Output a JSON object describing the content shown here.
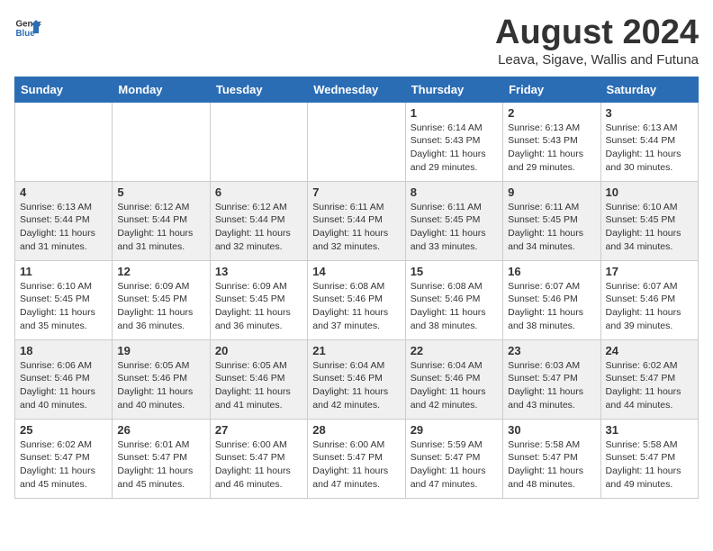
{
  "logo": {
    "general": "General",
    "blue": "Blue"
  },
  "title": {
    "month": "August 2024",
    "location": "Leava, Sigave, Wallis and Futuna"
  },
  "weekdays": [
    "Sunday",
    "Monday",
    "Tuesday",
    "Wednesday",
    "Thursday",
    "Friday",
    "Saturday"
  ],
  "weeks": [
    [
      {
        "day": "",
        "info": ""
      },
      {
        "day": "",
        "info": ""
      },
      {
        "day": "",
        "info": ""
      },
      {
        "day": "",
        "info": ""
      },
      {
        "day": "1",
        "info": "Sunrise: 6:14 AM\nSunset: 5:43 PM\nDaylight: 11 hours\nand 29 minutes."
      },
      {
        "day": "2",
        "info": "Sunrise: 6:13 AM\nSunset: 5:43 PM\nDaylight: 11 hours\nand 29 minutes."
      },
      {
        "day": "3",
        "info": "Sunrise: 6:13 AM\nSunset: 5:44 PM\nDaylight: 11 hours\nand 30 minutes."
      }
    ],
    [
      {
        "day": "4",
        "info": "Sunrise: 6:13 AM\nSunset: 5:44 PM\nDaylight: 11 hours\nand 31 minutes."
      },
      {
        "day": "5",
        "info": "Sunrise: 6:12 AM\nSunset: 5:44 PM\nDaylight: 11 hours\nand 31 minutes."
      },
      {
        "day": "6",
        "info": "Sunrise: 6:12 AM\nSunset: 5:44 PM\nDaylight: 11 hours\nand 32 minutes."
      },
      {
        "day": "7",
        "info": "Sunrise: 6:11 AM\nSunset: 5:44 PM\nDaylight: 11 hours\nand 32 minutes."
      },
      {
        "day": "8",
        "info": "Sunrise: 6:11 AM\nSunset: 5:45 PM\nDaylight: 11 hours\nand 33 minutes."
      },
      {
        "day": "9",
        "info": "Sunrise: 6:11 AM\nSunset: 5:45 PM\nDaylight: 11 hours\nand 34 minutes."
      },
      {
        "day": "10",
        "info": "Sunrise: 6:10 AM\nSunset: 5:45 PM\nDaylight: 11 hours\nand 34 minutes."
      }
    ],
    [
      {
        "day": "11",
        "info": "Sunrise: 6:10 AM\nSunset: 5:45 PM\nDaylight: 11 hours\nand 35 minutes."
      },
      {
        "day": "12",
        "info": "Sunrise: 6:09 AM\nSunset: 5:45 PM\nDaylight: 11 hours\nand 36 minutes."
      },
      {
        "day": "13",
        "info": "Sunrise: 6:09 AM\nSunset: 5:45 PM\nDaylight: 11 hours\nand 36 minutes."
      },
      {
        "day": "14",
        "info": "Sunrise: 6:08 AM\nSunset: 5:46 PM\nDaylight: 11 hours\nand 37 minutes."
      },
      {
        "day": "15",
        "info": "Sunrise: 6:08 AM\nSunset: 5:46 PM\nDaylight: 11 hours\nand 38 minutes."
      },
      {
        "day": "16",
        "info": "Sunrise: 6:07 AM\nSunset: 5:46 PM\nDaylight: 11 hours\nand 38 minutes."
      },
      {
        "day": "17",
        "info": "Sunrise: 6:07 AM\nSunset: 5:46 PM\nDaylight: 11 hours\nand 39 minutes."
      }
    ],
    [
      {
        "day": "18",
        "info": "Sunrise: 6:06 AM\nSunset: 5:46 PM\nDaylight: 11 hours\nand 40 minutes."
      },
      {
        "day": "19",
        "info": "Sunrise: 6:05 AM\nSunset: 5:46 PM\nDaylight: 11 hours\nand 40 minutes."
      },
      {
        "day": "20",
        "info": "Sunrise: 6:05 AM\nSunset: 5:46 PM\nDaylight: 11 hours\nand 41 minutes."
      },
      {
        "day": "21",
        "info": "Sunrise: 6:04 AM\nSunset: 5:46 PM\nDaylight: 11 hours\nand 42 minutes."
      },
      {
        "day": "22",
        "info": "Sunrise: 6:04 AM\nSunset: 5:46 PM\nDaylight: 11 hours\nand 42 minutes."
      },
      {
        "day": "23",
        "info": "Sunrise: 6:03 AM\nSunset: 5:47 PM\nDaylight: 11 hours\nand 43 minutes."
      },
      {
        "day": "24",
        "info": "Sunrise: 6:02 AM\nSunset: 5:47 PM\nDaylight: 11 hours\nand 44 minutes."
      }
    ],
    [
      {
        "day": "25",
        "info": "Sunrise: 6:02 AM\nSunset: 5:47 PM\nDaylight: 11 hours\nand 45 minutes."
      },
      {
        "day": "26",
        "info": "Sunrise: 6:01 AM\nSunset: 5:47 PM\nDaylight: 11 hours\nand 45 minutes."
      },
      {
        "day": "27",
        "info": "Sunrise: 6:00 AM\nSunset: 5:47 PM\nDaylight: 11 hours\nand 46 minutes."
      },
      {
        "day": "28",
        "info": "Sunrise: 6:00 AM\nSunset: 5:47 PM\nDaylight: 11 hours\nand 47 minutes."
      },
      {
        "day": "29",
        "info": "Sunrise: 5:59 AM\nSunset: 5:47 PM\nDaylight: 11 hours\nand 47 minutes."
      },
      {
        "day": "30",
        "info": "Sunrise: 5:58 AM\nSunset: 5:47 PM\nDaylight: 11 hours\nand 48 minutes."
      },
      {
        "day": "31",
        "info": "Sunrise: 5:58 AM\nSunset: 5:47 PM\nDaylight: 11 hours\nand 49 minutes."
      }
    ]
  ]
}
